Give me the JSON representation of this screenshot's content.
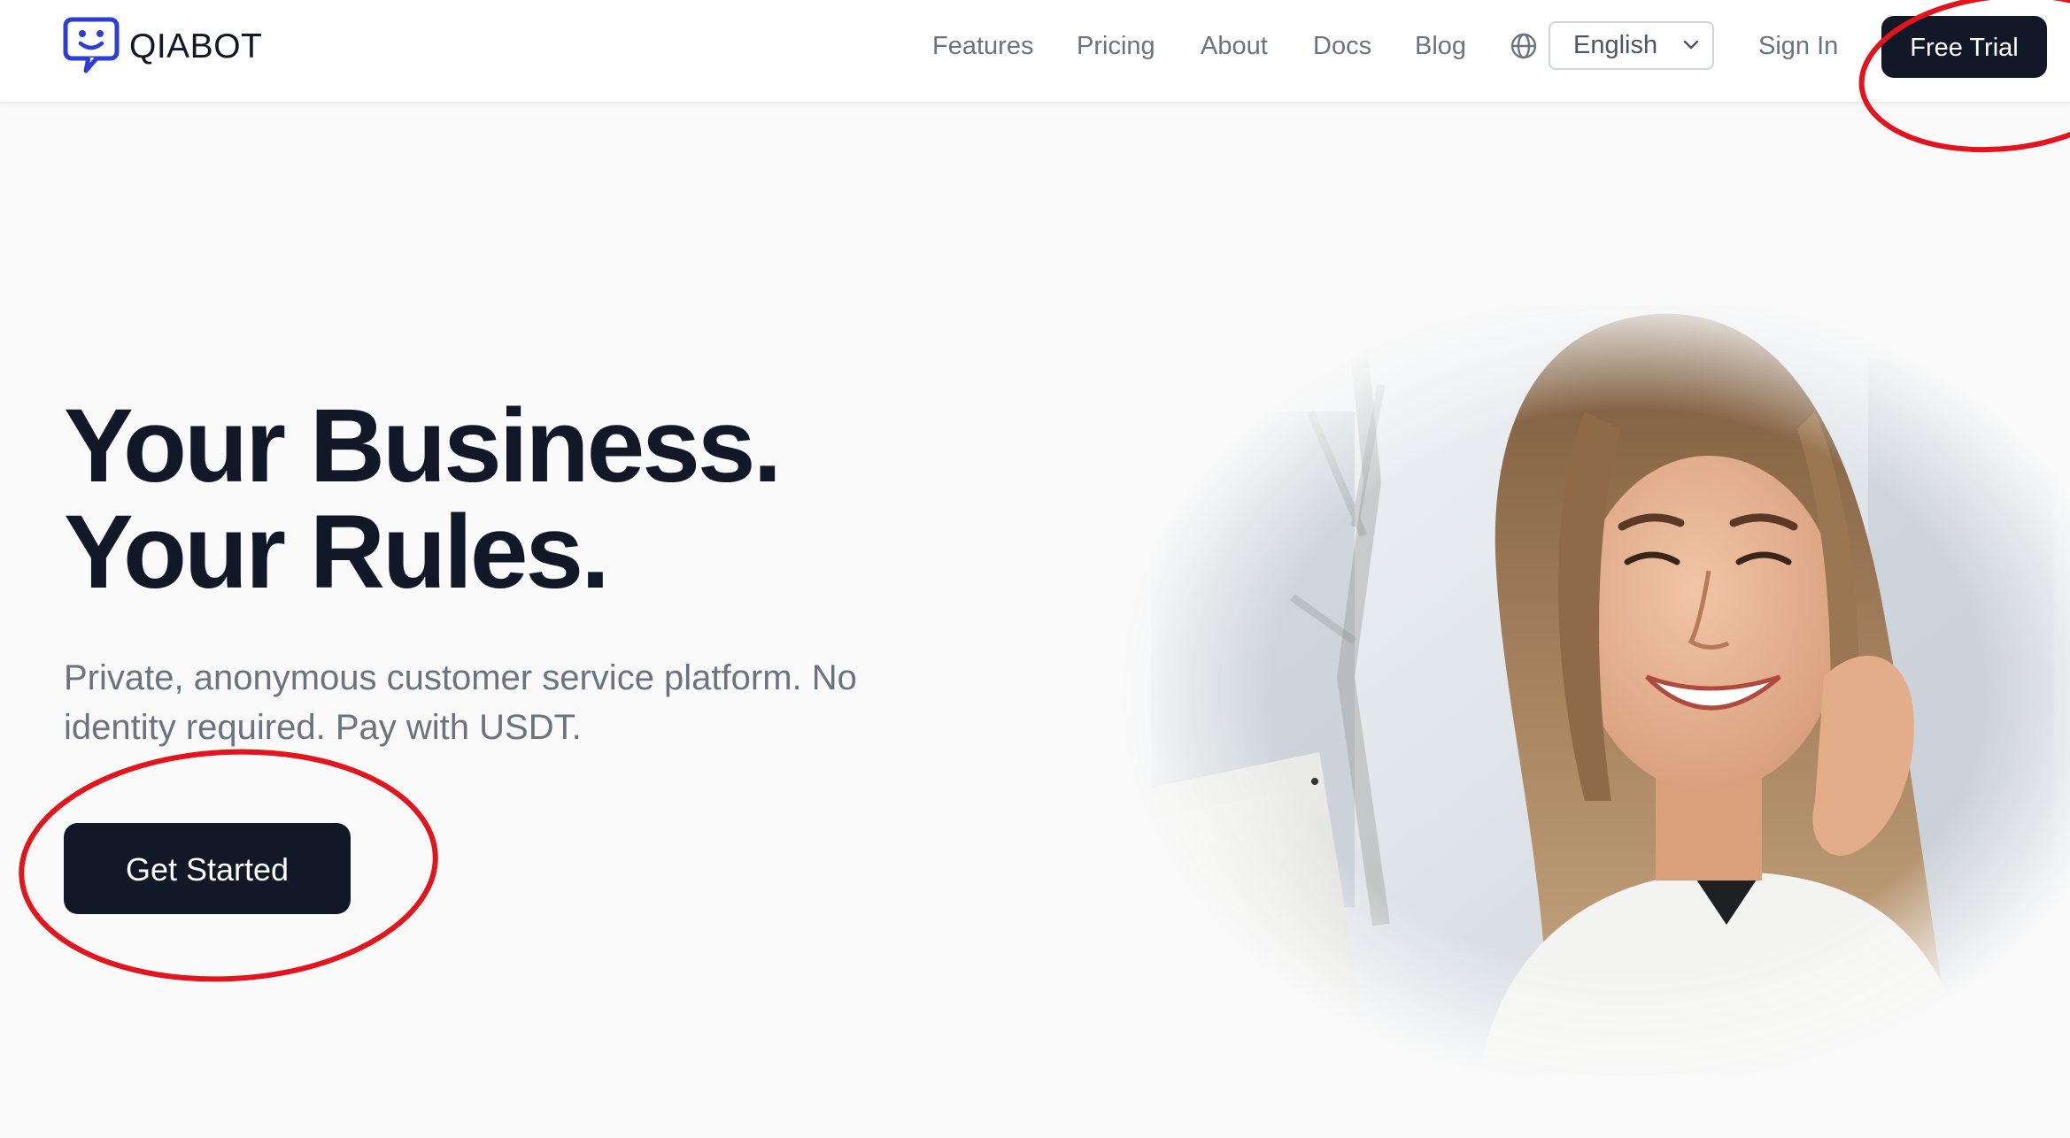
{
  "brand": {
    "name": "QIABOT",
    "logo_icon": "chat-bubble-smiley-icon",
    "accent_color": "#2d3ed8"
  },
  "nav": {
    "links": [
      "Features",
      "Pricing",
      "About",
      "Docs",
      "Blog"
    ],
    "language_icon": "globe-icon",
    "language": {
      "selected": "English",
      "icon": "chevron-down-icon"
    },
    "sign_in": "Sign In",
    "free_trial": "Free Trial"
  },
  "hero": {
    "title_line1": "Your Business.",
    "title_line2": "Your Rules.",
    "subtitle": "Private, anonymous customer service platform. No identity required. Pay with USDT.",
    "cta": "Get Started",
    "image": "smiling-woman-on-phone-photo"
  },
  "annotations": {
    "shape": "red-ellipse",
    "color": "#e3141b",
    "targets": [
      "Free Trial",
      "Get Started"
    ]
  },
  "colors": {
    "primary_button": "#111827",
    "heading_text": "#111827",
    "muted_text": "#6b7280",
    "background": "#fafafa"
  }
}
